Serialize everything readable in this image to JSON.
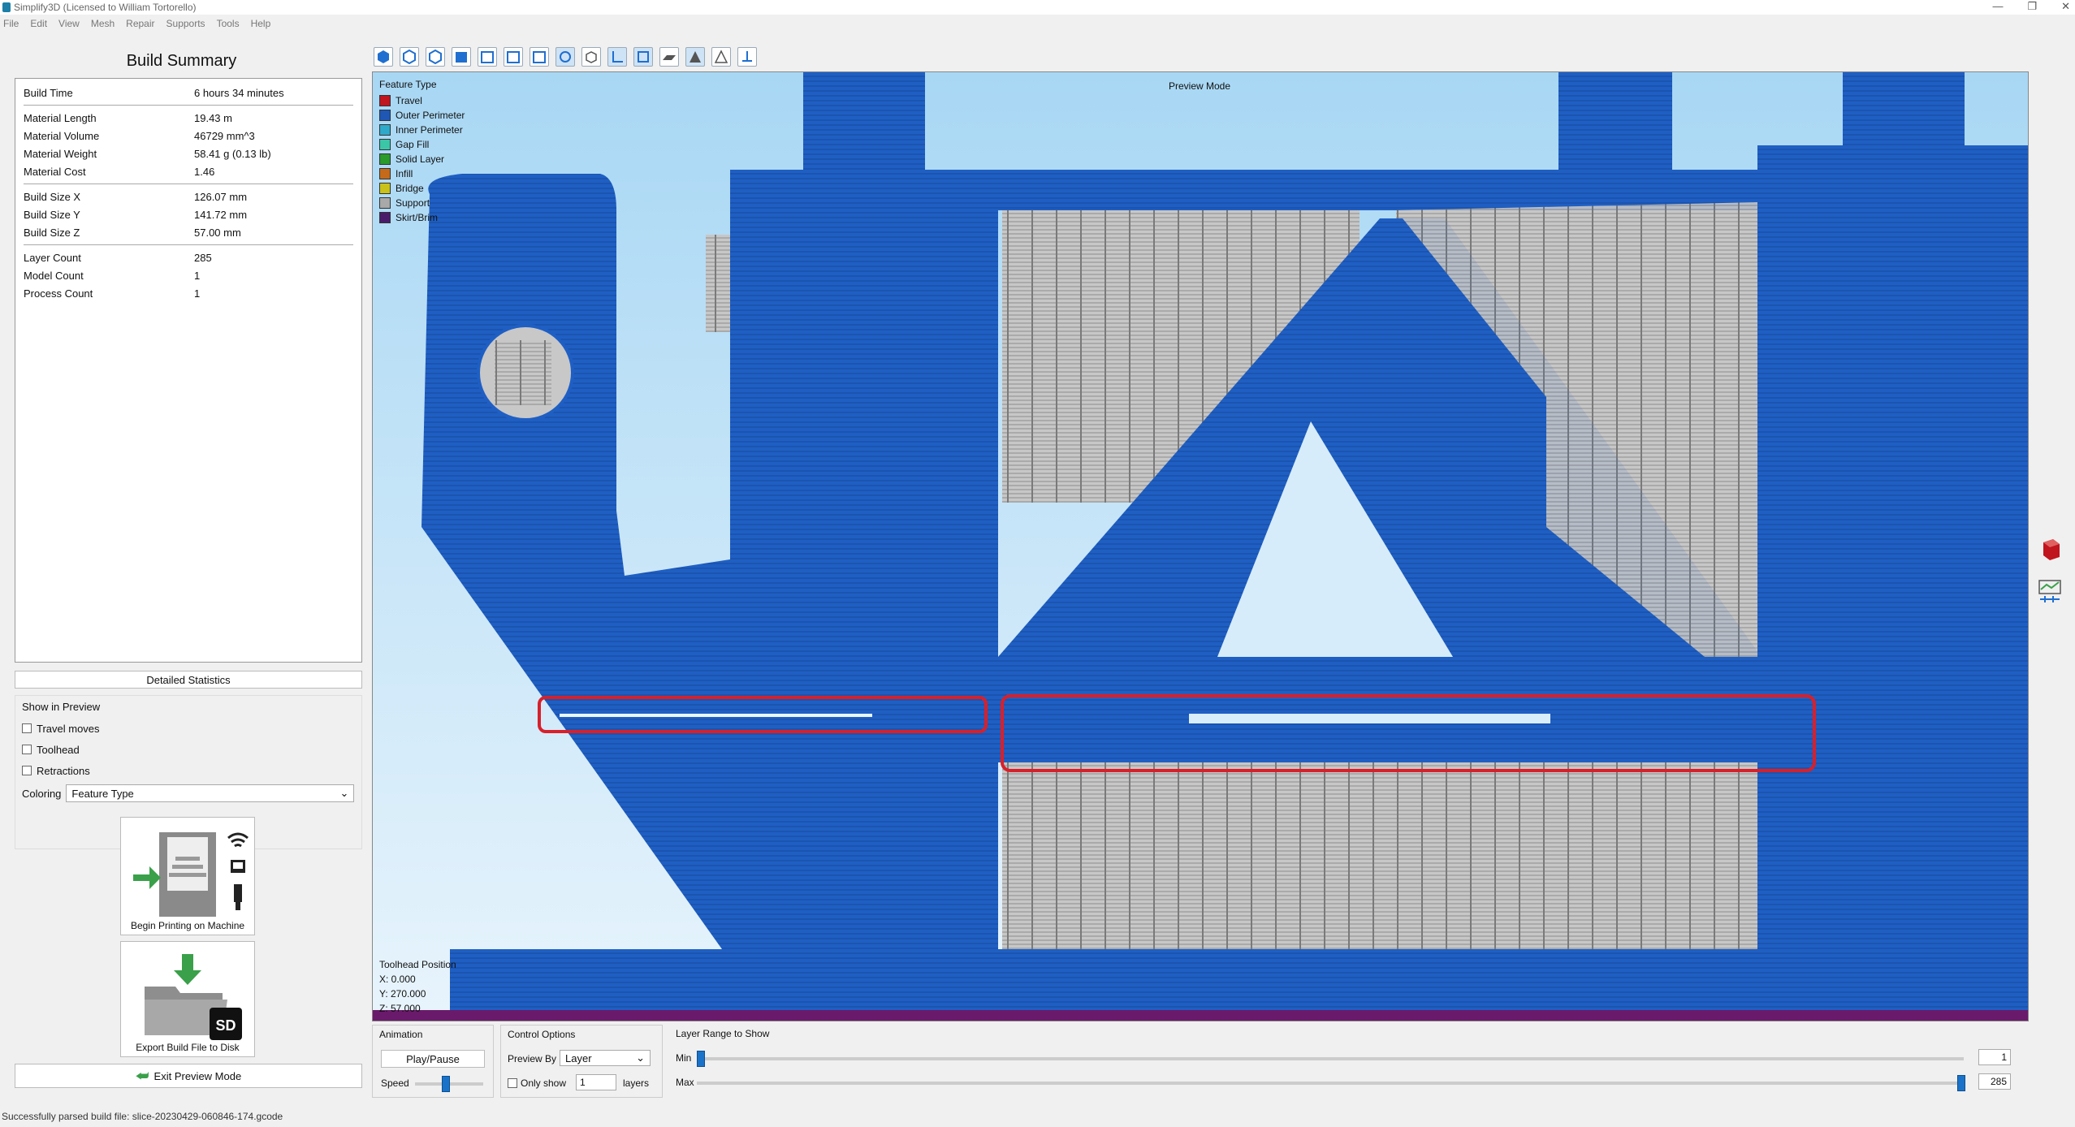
{
  "window": {
    "title": "Simplify3D (Licensed to William Tortorello)",
    "min": "—",
    "max": "❐",
    "close": "✕"
  },
  "menu": [
    "File",
    "Edit",
    "View",
    "Mesh",
    "Repair",
    "Supports",
    "Tools",
    "Help"
  ],
  "summary": {
    "title": "Build Summary",
    "group1": [
      {
        "k": "Build Time",
        "v": "6 hours 34 minutes"
      }
    ],
    "group2": [
      {
        "k": "Material Length",
        "v": "19.43 m"
      },
      {
        "k": "Material Volume",
        "v": "46729 mm^3"
      },
      {
        "k": "Material Weight",
        "v": "58.41 g (0.13 lb)"
      },
      {
        "k": "Material Cost",
        "v": "1.46"
      }
    ],
    "group3": [
      {
        "k": "Build Size X",
        "v": "126.07 mm"
      },
      {
        "k": "Build Size Y",
        "v": "141.72 mm"
      },
      {
        "k": "Build Size Z",
        "v": "57.00 mm"
      }
    ],
    "group4": [
      {
        "k": "Layer Count",
        "v": "285"
      },
      {
        "k": "Model Count",
        "v": "1"
      },
      {
        "k": "Process Count",
        "v": "1"
      }
    ],
    "detailed_btn": "Detailed Statistics"
  },
  "show_in_preview": {
    "header": "Show in Preview",
    "travel": "Travel moves",
    "toolhead": "Toolhead",
    "retractions": "Retractions",
    "coloring_label": "Coloring",
    "coloring_value": "Feature Type"
  },
  "actions": {
    "begin_printing": "Begin Printing on Machine",
    "export": "Export Build File to Disk",
    "exit": "Exit Preview Mode",
    "sd_label": "SD"
  },
  "viewport": {
    "mode": "Preview Mode",
    "legend_title": "Feature Type",
    "legend": [
      {
        "name": "Travel",
        "color": "#c0141e"
      },
      {
        "name": "Outer Perimeter",
        "color": "#1f57b5"
      },
      {
        "name": "Inner Perimeter",
        "color": "#2ea9c9"
      },
      {
        "name": "Gap Fill",
        "color": "#3cc6a8"
      },
      {
        "name": "Solid Layer",
        "color": "#2a9a2a"
      },
      {
        "name": "Infill",
        "color": "#c46a1a"
      },
      {
        "name": "Bridge",
        "color": "#c9c21a"
      },
      {
        "name": "Support",
        "color": "#a9a9a9"
      },
      {
        "name": "Skirt/Brim",
        "color": "#4a1a6a"
      }
    ],
    "toolhead_title": "Toolhead Position",
    "x": "X: 0.000",
    "y": "Y: 270.000",
    "z": "Z: 57.000"
  },
  "bottom": {
    "animation": "Animation",
    "play": "Play/Pause",
    "speed": "Speed",
    "speed_level": 0.45,
    "control": "Control Options",
    "preview_by": "Preview By",
    "preview_by_value": "Layer",
    "only_show": "Only show",
    "only_show_value": "1",
    "layers": "layers",
    "range": "Layer Range to Show",
    "min_label": "Min",
    "min_value": "1",
    "max_label": "Max",
    "max_value": "285"
  },
  "status": "Successfully parsed build file: slice-20230429-060846-174.gcode",
  "colors": {
    "blue": "#1f5fc4",
    "support": "#b9b9b9",
    "highlight": "#d8202a"
  }
}
